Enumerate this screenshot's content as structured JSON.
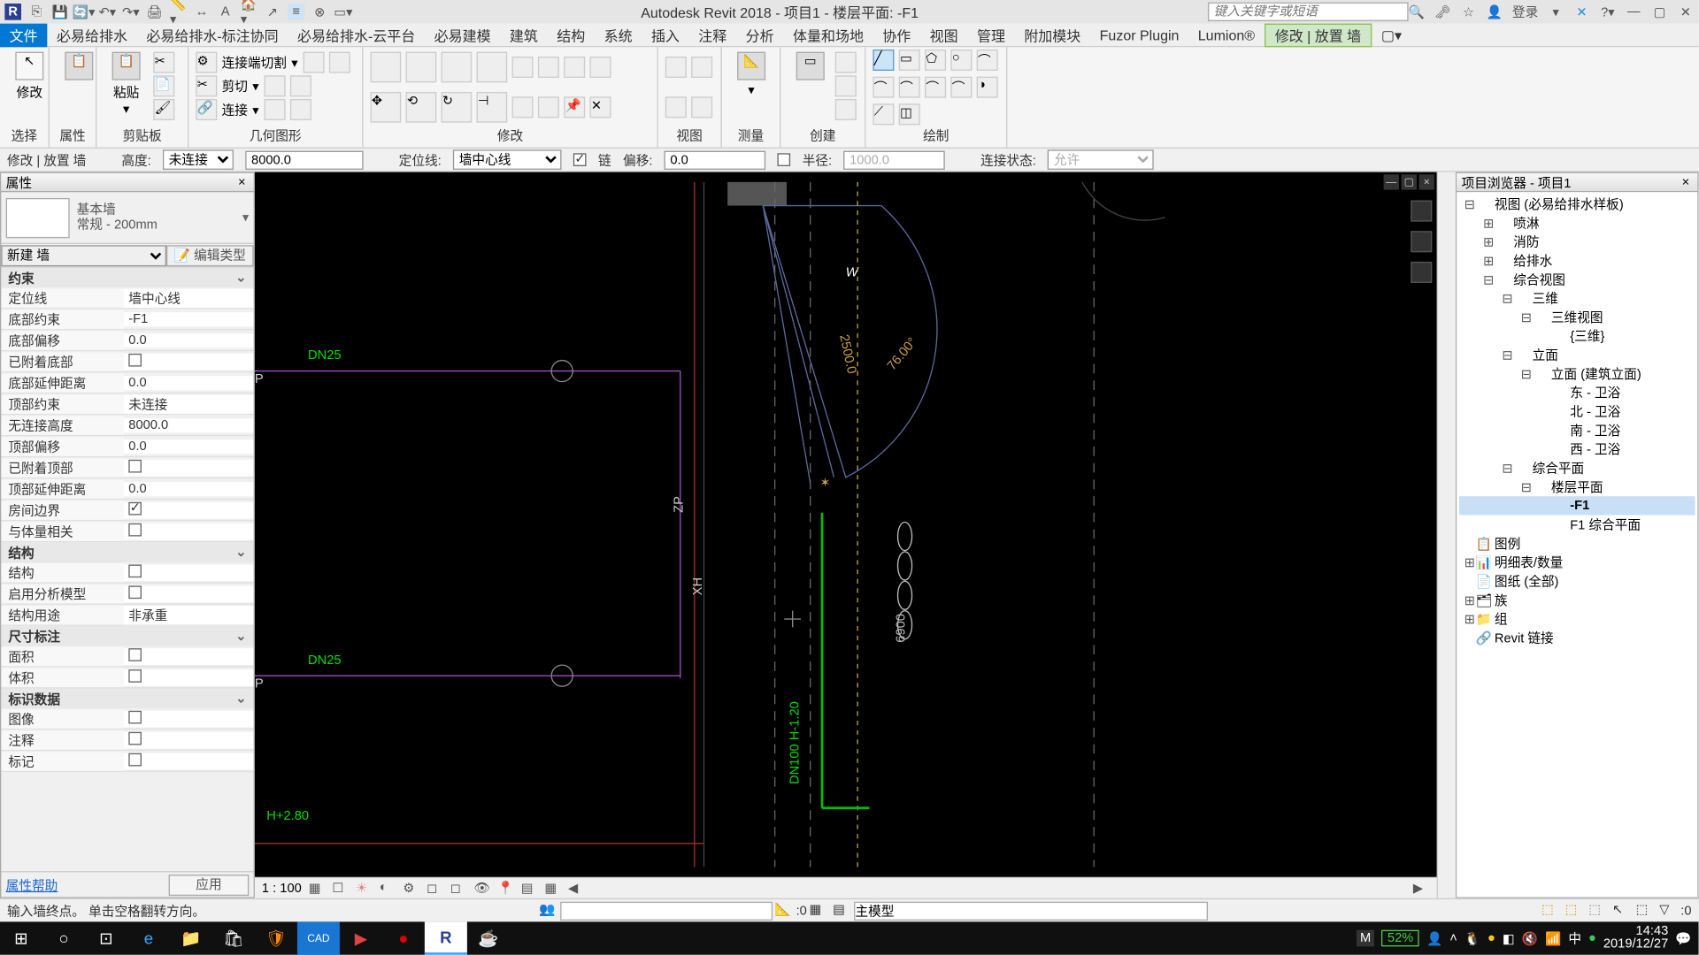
{
  "title": "Autodesk Revit 2018 -   项目1 - 楼层平面: -F1",
  "search_placeholder": "键入关键字或短语",
  "login_label": "登录",
  "ribbon_tabs": [
    "文件",
    "必易给排水",
    "必易给排水-标注协同",
    "必易给排水-云平台",
    "必易建模",
    "建筑",
    "结构",
    "系统",
    "插入",
    "注释",
    "分析",
    "体量和场地",
    "协作",
    "视图",
    "管理",
    "附加模块",
    "Fuzor Plugin",
    "Lumion®",
    "修改 | 放置 墙"
  ],
  "ribbon_groups": [
    "选择",
    "属性",
    "剪贴板",
    "几何图形",
    "修改",
    "视图",
    "测量",
    "创建",
    "绘制"
  ],
  "ribbon_labels": {
    "modify": "修改",
    "paste": "粘贴",
    "join_end": "连接端切割",
    "cut": "剪切",
    "join": "连接"
  },
  "context_tab": "修改 | 放置 墙",
  "options_bar": {
    "height_label": "高度:",
    "height_sel": "未连接",
    "height_val": "8000.0",
    "loc_label": "定位线:",
    "loc_sel": "墙中心线",
    "chain": "链",
    "offset_label": "偏移:",
    "offset_val": "0.0",
    "radius_label": "半径:",
    "radius_val": "1000.0",
    "join_label": "连接状态:",
    "join_sel": "允许"
  },
  "properties": {
    "panel_title": "属性",
    "type_name": "基本墙",
    "type_desc": "常规 - 200mm",
    "new_sel": "新建 墙",
    "edit_type": "编辑类型",
    "sections": {
      "constraint": "约束",
      "struct": "结构",
      "dim": "尺寸标注",
      "id": "标识数据"
    },
    "rows": [
      [
        "定位线",
        "墙中心线"
      ],
      [
        "底部约束",
        "-F1"
      ],
      [
        "底部偏移",
        "0.0"
      ],
      [
        "已附着底部",
        ""
      ],
      [
        "底部延伸距离",
        "0.0"
      ],
      [
        "顶部约束",
        "未连接"
      ],
      [
        "无连接高度",
        "8000.0"
      ],
      [
        "顶部偏移",
        "0.0"
      ],
      [
        "已附着顶部",
        ""
      ],
      [
        "顶部延伸距离",
        "0.0"
      ],
      [
        "房间边界",
        "✓"
      ],
      [
        "与体量相关",
        ""
      ]
    ],
    "struct_rows": [
      [
        "结构",
        ""
      ],
      [
        "启用分析模型",
        ""
      ],
      [
        "结构用途",
        "非承重"
      ]
    ],
    "dim_rows": [
      [
        "面积",
        ""
      ],
      [
        "体积",
        ""
      ]
    ],
    "id_rows": [
      [
        "图像",
        ""
      ],
      [
        "注释",
        ""
      ],
      [
        "标记",
        ""
      ]
    ],
    "help": "属性帮助",
    "apply": "应用"
  },
  "canvas_labels": {
    "dn25": "DN25",
    "zp": "ZP",
    "xh": "XH",
    "dn100": "DN100  H-1.20",
    "dim6900": "6900",
    "h280": "H+2.80",
    "w": "W",
    "ang": "76.00°",
    "len": "2500.0"
  },
  "view_scale": "1 : 100",
  "browser": {
    "title": "项目浏览器 - 项目1",
    "tree": [
      {
        "d": 0,
        "t": "⊟",
        "l": "视图 (必易给排水样板)"
      },
      {
        "d": 1,
        "t": "⊞",
        "l": "喷淋"
      },
      {
        "d": 1,
        "t": "⊞",
        "l": "消防"
      },
      {
        "d": 1,
        "t": "⊞",
        "l": "给排水"
      },
      {
        "d": 1,
        "t": "⊟",
        "l": "综合视图"
      },
      {
        "d": 2,
        "t": "⊟",
        "l": "三维"
      },
      {
        "d": 3,
        "t": "⊟",
        "l": "三维视图"
      },
      {
        "d": 4,
        "t": "",
        "l": "{三维}"
      },
      {
        "d": 2,
        "t": "⊟",
        "l": "立面"
      },
      {
        "d": 3,
        "t": "⊟",
        "l": "立面 (建筑立面)"
      },
      {
        "d": 4,
        "t": "",
        "l": "东 - 卫浴"
      },
      {
        "d": 4,
        "t": "",
        "l": "北 - 卫浴"
      },
      {
        "d": 4,
        "t": "",
        "l": "南 - 卫浴"
      },
      {
        "d": 4,
        "t": "",
        "l": "西 - 卫浴"
      },
      {
        "d": 2,
        "t": "⊟",
        "l": "综合平面"
      },
      {
        "d": 3,
        "t": "⊟",
        "l": "楼层平面"
      },
      {
        "d": 4,
        "t": "",
        "l": "-F1",
        "sel": true
      },
      {
        "d": 4,
        "t": "",
        "l": "F1 综合平面"
      },
      {
        "d": 0,
        "t": "",
        "l": "图例",
        "ic": "📋"
      },
      {
        "d": 0,
        "t": "⊞",
        "l": "明细表/数量",
        "ic": "📊"
      },
      {
        "d": 0,
        "t": "",
        "l": "图纸 (全部)",
        "ic": "📄"
      },
      {
        "d": 0,
        "t": "⊞",
        "l": "族",
        "ic": "🗂"
      },
      {
        "d": 0,
        "t": "⊞",
        "l": "组",
        "ic": "📁"
      },
      {
        "d": 0,
        "t": "",
        "l": "Revit 链接",
        "ic": "🔗"
      }
    ]
  },
  "status": {
    "msg": "输入墙终点。 单击空格翻转方向。",
    "zero": ":0",
    "main_model": "主模型",
    "filter": ":0"
  },
  "taskbar": {
    "time": "14:43",
    "date": "2019/12/27",
    "battery": "52%"
  }
}
